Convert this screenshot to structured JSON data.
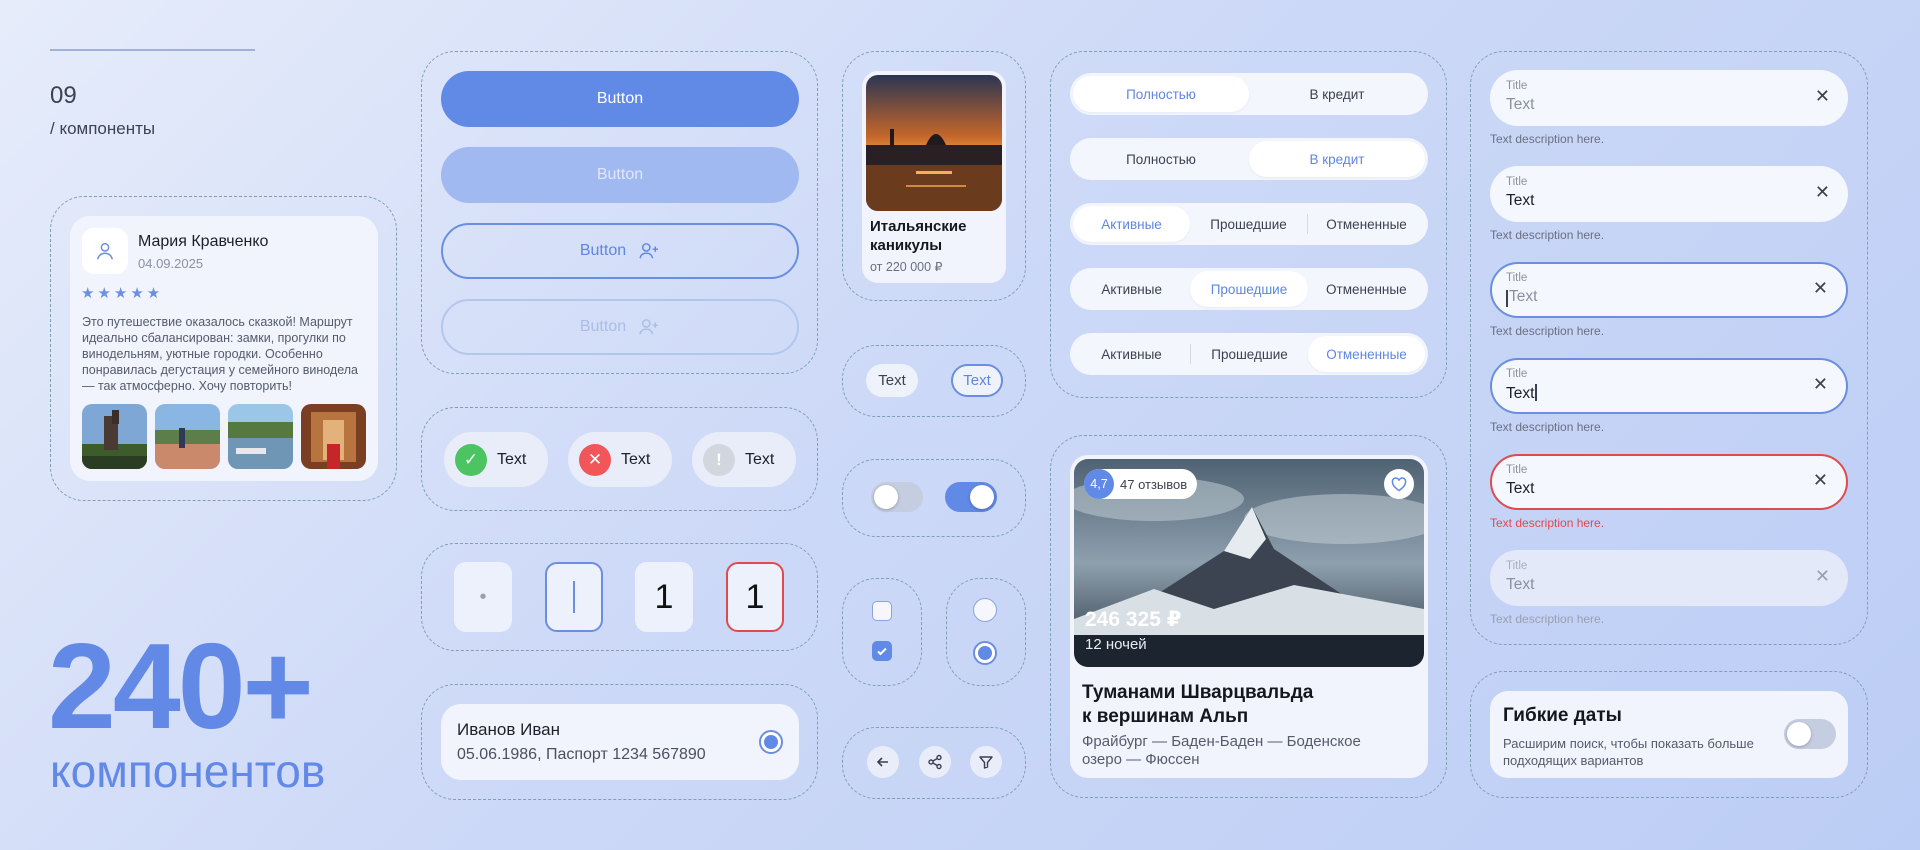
{
  "header": {
    "number": "09",
    "subtitle": "/ компоненты"
  },
  "promo": {
    "count": "240+",
    "word": "компонентов"
  },
  "review": {
    "name": "Мария Кравченко",
    "date": "04.09.2025",
    "rating": 5,
    "stars": "★★★★★",
    "text": "Это путешествие оказалось сказкой! Маршрут идеально сбалансирован: замки, прогулки по винодельням, уютные городки. Особенно понравилась дегустация у семейного винодела — так атмосферно. Хочу повторить!"
  },
  "buttons": {
    "primary": "Button",
    "primary_disabled": "Button",
    "outline": "Button",
    "outline_disabled": "Button"
  },
  "chips": [
    {
      "label": "Text",
      "status": "success",
      "icon": "check-icon",
      "color": "#4cc462"
    },
    {
      "label": "Text",
      "status": "error",
      "icon": "close-icon",
      "color": "#f0565a"
    },
    {
      "label": "Text",
      "status": "disabled",
      "icon": "info-icon",
      "color": "#d2d6de"
    }
  ],
  "code_inputs": {
    "dot": "•",
    "filled1": "1",
    "filled2": "1"
  },
  "passenger": {
    "name": "Иванов Иван",
    "document": "05.06.1986, Паспорт 1234 567890"
  },
  "tour": {
    "title": "Итальянские каникулы",
    "price": "от 220 000 ₽"
  },
  "tags": {
    "plain": "Text",
    "outlined": "Text"
  },
  "segmented": [
    {
      "items": [
        "Полностью",
        "В кредит"
      ],
      "active": 0
    },
    {
      "items": [
        "Полностью",
        "В кредит"
      ],
      "active": 1
    },
    {
      "items": [
        "Активные",
        "Прошедшие",
        "Отмененные"
      ],
      "active": 0
    },
    {
      "items": [
        "Активные",
        "Прошедшие",
        "Отмененные"
      ],
      "active": 1
    },
    {
      "items": [
        "Активные",
        "Прошедшие",
        "Отмененные"
      ],
      "active": 2
    }
  ],
  "hotel": {
    "rating": "4,7",
    "reviews": "47 отзывов",
    "price": "246 325 ₽",
    "nights": "12 ночей",
    "title_line1": "Туманами Шварцвальда",
    "title_line2": "к вершинам Альп",
    "route_line1": "Фрайбург —  Баден-Баден — Боденское",
    "route_line2": "озеро  — Фюссен"
  },
  "fields": [
    {
      "label": "Title",
      "value": "Text",
      "desc": "Text description here.",
      "state": "placeholder"
    },
    {
      "label": "Title",
      "value": "Text",
      "desc": "Text description here.",
      "state": "filled"
    },
    {
      "label": "Title",
      "value": "Text",
      "desc": "Text description here.",
      "state": "focused-empty"
    },
    {
      "label": "Title",
      "value": "Text",
      "desc": "Text description here.",
      "state": "focused-filled"
    },
    {
      "label": "Title",
      "value": "Text",
      "desc": "Text description here.",
      "state": "error"
    },
    {
      "label": "Title",
      "value": "Text",
      "desc": "Text description here.",
      "state": "disabled"
    }
  ],
  "flex_dates": {
    "title": "Гибкие даты",
    "subtitle_line1": "Расширим поиск, чтобы показать больше",
    "subtitle_line2": "подходящих вариантов",
    "enabled": false
  },
  "colors": {
    "accent": "#6189e6",
    "error": "#e04a4f",
    "success": "#4cc462"
  }
}
